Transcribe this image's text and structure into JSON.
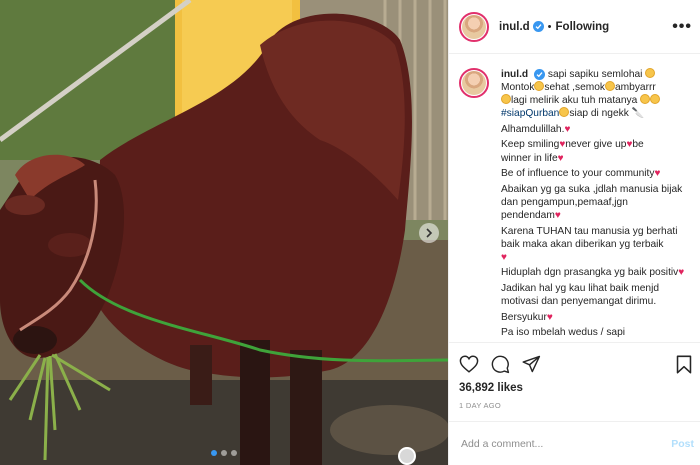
{
  "header": {
    "username": "inul.d",
    "separator": "•",
    "follow_status": "Following",
    "more": "•••"
  },
  "caption": {
    "username": "inul.d",
    "lines": {
      "l1": "sapi sapiku semlohai",
      "l2a": "Montok",
      "l2b": "sehat ,semok",
      "l2c": "ambyarrr",
      "l3": "lagi melirik aku tuh matanya",
      "hashtag": "#siapQurban",
      "l4b": "siap di ngekk",
      "l5": "Alhamdulillah.",
      "l6a": "Keep smiling",
      "l6b": "never give up",
      "l6c": "be",
      "l7": "winner in life",
      "l8": "Be of influence to your community",
      "l9": "Abaikan yg ga suka ,jdlah manusia bijak dan pengampun,pemaaf,jgn pendendam",
      "l10": "Karena TUHAN tau manusia yg berhati baik maka akan diberikan yg terbaik",
      "l11": "Hiduplah dgn prasangka yg baik positiv",
      "l12": "Jadikan hal yg kau lihat baik menjd motivasi dan penyemangat dirimu.",
      "l13": "Bersyukur",
      "l14": "Pa iso mbelah wedus / sapi"
    }
  },
  "icons": {
    "heart": "heart-icon",
    "comment": "comment-icon",
    "share": "share-icon",
    "save": "bookmark-icon"
  },
  "likes": "36,892 likes",
  "time": "1 DAY AGO",
  "comment_box": {
    "placeholder": "Add a comment...",
    "post_label": "Post"
  },
  "colors": {
    "accent": "#3897f0",
    "heart": "#e0245e",
    "post_disabled": "#b2dffc"
  }
}
